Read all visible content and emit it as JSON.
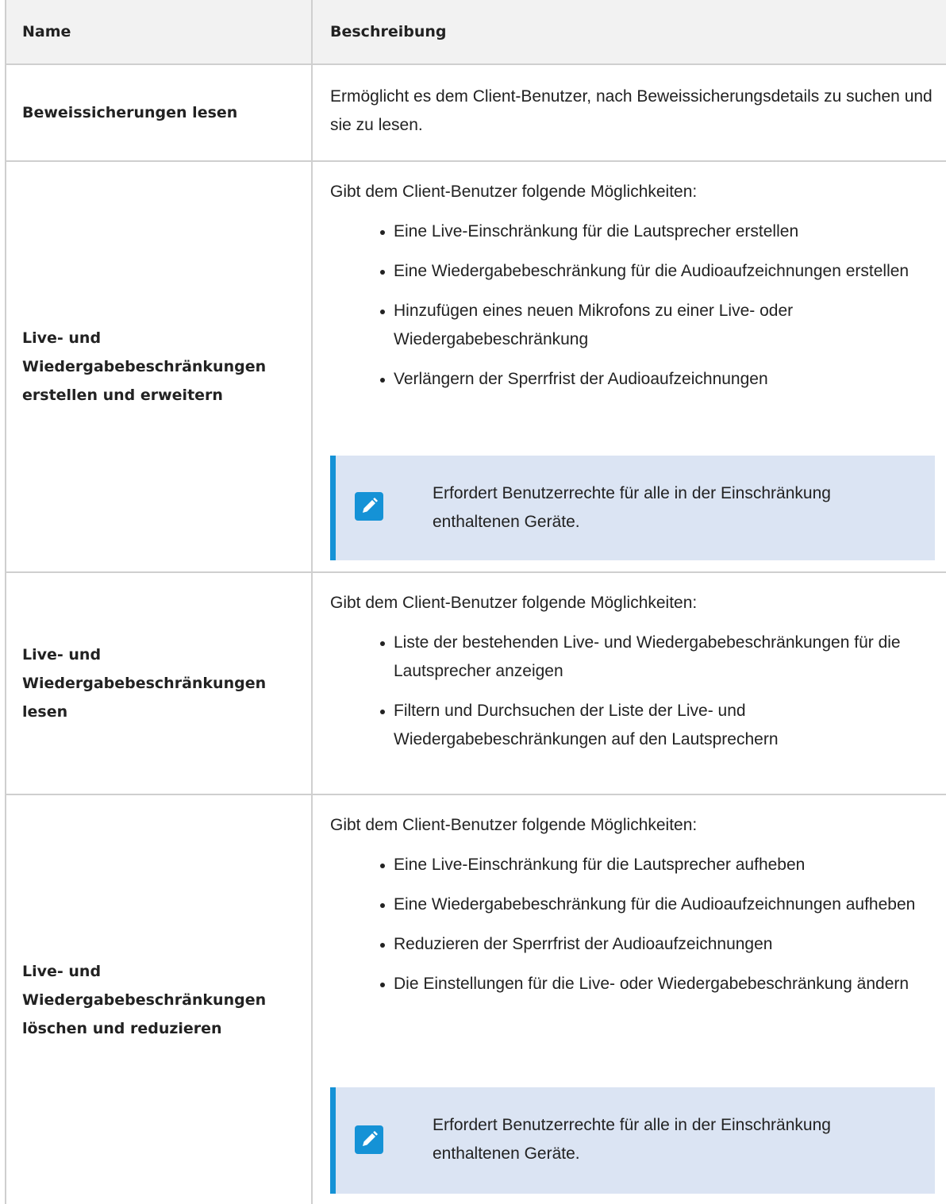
{
  "table": {
    "header": {
      "name": "Name",
      "description": "Beschreibung"
    },
    "rows": [
      {
        "name": "Beweissicherungen lesen",
        "description": "Ermöglicht es dem Client-Benutzer, nach Beweissicherungsdetails zu suchen und sie zu lesen."
      },
      {
        "name": "Live- und Wiedergabebeschränkungen erstellen und erweitern",
        "intro": "Gibt dem Client-Benutzer folgende Möglichkeiten:",
        "bullets": [
          "Eine Live-Einschränkung für die Lautsprecher erstellen",
          "Eine Wiedergabebeschränkung für die Audioaufzeichnungen erstellen",
          "Hinzufügen eines neuen Mikrofons zu einer Live- oder Wiedergabebeschränkung",
          "Verlängern der Sperrfrist der Audioaufzeichnungen"
        ],
        "note": {
          "icon": "pencil-note-icon",
          "text": "Erfordert Benutzerrechte für alle in der Einschränkung enthaltenen Geräte."
        }
      },
      {
        "name": "Live- und Wiedergabebeschränkungen lesen",
        "intro": "Gibt dem Client-Benutzer folgende Möglichkeiten:",
        "bullets": [
          "Liste der bestehenden Live- und Wiedergabebeschränkungen für die Lautsprecher anzeigen",
          "Filtern und Durchsuchen der Liste der Live- und Wiedergabebeschränkungen auf den Lautsprechern"
        ]
      },
      {
        "name": "Live- und Wiedergabebeschränkungen löschen und reduzieren",
        "intro": "Gibt dem Client-Benutzer folgende Möglichkeiten:",
        "bullets": [
          "Eine Live-Einschränkung für die Lautsprecher aufheben",
          "Eine Wiedergabebeschränkung für die Audioaufzeichnungen aufheben",
          "Reduzieren der Sperrfrist der Audioaufzeichnungen",
          "Die Einstellungen für die Live- oder Wiedergabebeschränkung ändern"
        ],
        "note": {
          "icon": "pencil-note-icon",
          "text": "Erfordert Benutzerrechte für alle in der Einschränkung enthaltenen Geräte."
        }
      }
    ],
    "colors": {
      "header_bg": "#f2f2f2",
      "border": "#cfcfcf",
      "note_bg": "#dbe4f3",
      "note_accent": "#1592d6"
    }
  }
}
